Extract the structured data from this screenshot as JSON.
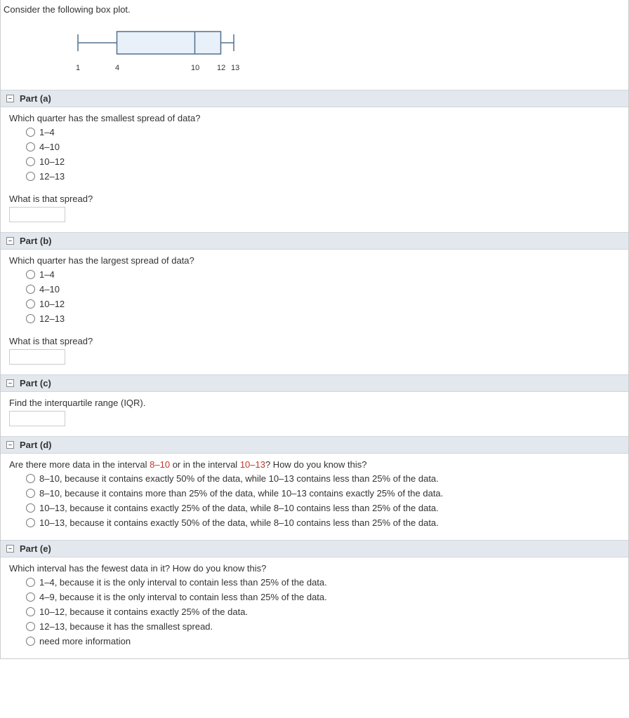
{
  "intro": "Consider the following box plot.",
  "chart_data": {
    "type": "boxplot",
    "min": 1,
    "q1": 4,
    "median": 10,
    "q3": 12,
    "max": 13,
    "tick_labels": [
      "1",
      "4",
      "10",
      "12",
      "13"
    ]
  },
  "parts": {
    "a": {
      "title": "Part (a)",
      "question": "Which quarter has the smallest spread of data?",
      "options": [
        "1–4",
        "4–10",
        "10–12",
        "12–13"
      ],
      "subq": "What is that spread?"
    },
    "b": {
      "title": "Part (b)",
      "question": "Which quarter has the largest spread of data?",
      "options": [
        "1–4",
        "4–10",
        "10–12",
        "12–13"
      ],
      "subq": "What is that spread?"
    },
    "c": {
      "title": "Part (c)",
      "question": "Find the interquartile range (IQR)."
    },
    "d": {
      "title": "Part (d)",
      "q_pre": "Are there more data in the interval ",
      "q_red1": "8–10",
      "q_mid": " or in the interval ",
      "q_red2": "10–13",
      "q_post": "? How do you know this?",
      "options": [
        "8–10, because it contains exactly 50% of the data, while 10–13 contains less than 25% of the data.",
        "8–10, because it contains more than 25% of the data, while 10–13 contains exactly 25% of the data.",
        "10–13, because it contains exactly 25% of the data, while 8–10 contains less than 25% of the data.",
        "10–13, because it contains exactly 50% of the data, while 8–10 contains less than 25% of the data."
      ]
    },
    "e": {
      "title": "Part (e)",
      "question": "Which interval has the fewest data in it? How do you know this?",
      "options": [
        "1–4, because it is the only interval to contain less than 25% of the data.",
        "4–9, because it is the only interval to contain less than 25% of the data.",
        "10–12, because it contains exactly 25% of the data.",
        "12–13, because it has the smallest spread.",
        "need more information"
      ]
    }
  }
}
